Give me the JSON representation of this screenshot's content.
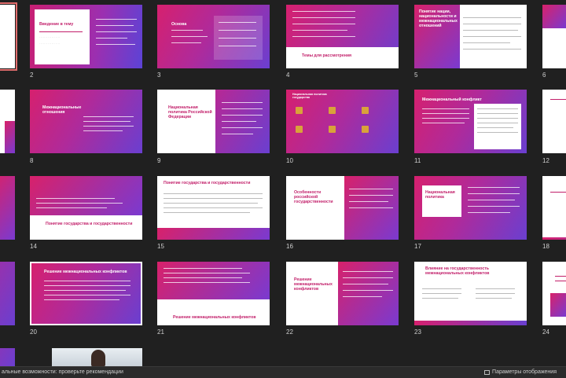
{
  "slides": [
    {
      "n": "2",
      "title": "Введение в тему"
    },
    {
      "n": "3",
      "title": "Основа"
    },
    {
      "n": "4",
      "title": "Темы для рассмотрения"
    },
    {
      "n": "5",
      "title": "Понятие нации, национальности и межнациональных отношений"
    },
    {
      "n": "6",
      "title": ""
    },
    {
      "n": "8",
      "title": "Межнациональные отношения"
    },
    {
      "n": "9",
      "title": "Национальная политика Российской Федерации"
    },
    {
      "n": "10",
      "title": "Национальная политика государства"
    },
    {
      "n": "11",
      "title": "Межнациональный конфликт"
    },
    {
      "n": "12",
      "title": ""
    },
    {
      "n": "14",
      "title": "Понятие государства и государственности"
    },
    {
      "n": "15",
      "title": "Понятие государства и государственности"
    },
    {
      "n": "16",
      "title": "Особенности российской государственности"
    },
    {
      "n": "17",
      "title": "Национальная политика"
    },
    {
      "n": "18",
      "title": ""
    },
    {
      "n": "20",
      "title": "Решение межнациональных конфликтов"
    },
    {
      "n": "21",
      "title": "Решение межнациональных конфликтов"
    },
    {
      "n": "22",
      "title": "Решение межнациональных конфликтов"
    },
    {
      "n": "23",
      "title": "Влияние на государственность межнациональных конфликтов"
    },
    {
      "n": "24",
      "title": ""
    }
  ],
  "status": {
    "left": "альные возможности: проверьте рекомендации",
    "right": "Параметры отображения"
  }
}
